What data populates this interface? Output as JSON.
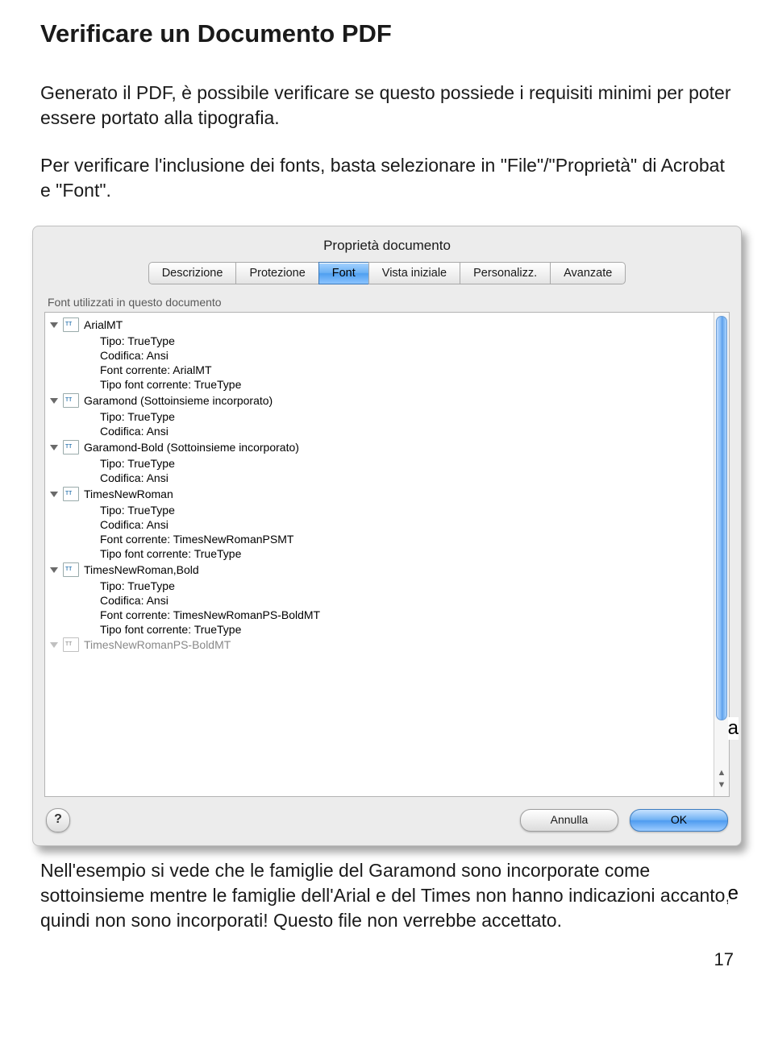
{
  "heading": "Verificare un Documento PDF",
  "intro1": "Generato il PDF, è possibile verificare se questo possiede i requisiti minimi per poter essere portato alla tipografia.",
  "intro2": "Per verificare l'inclusione dei fonts, basta selezionare in \"File\"/\"Proprietà\" di Acrobat e \"Font\".",
  "dialog": {
    "title": "Proprietà documento",
    "tabs": [
      "Descrizione",
      "Protezione",
      "Font",
      "Vista iniziale",
      "Personalizz.",
      "Avanzate"
    ],
    "active_tab": 2,
    "group_label": "Font utilizzati in questo documento",
    "fonts": [
      {
        "name": "ArialMT",
        "details": [
          "Tipo: TrueType",
          "Codifica: Ansi",
          "Font corrente: ArialMT",
          "Tipo font corrente: TrueType"
        ]
      },
      {
        "name": "Garamond (Sottoinsieme incorporato)",
        "details": [
          "Tipo: TrueType",
          "Codifica: Ansi"
        ]
      },
      {
        "name": "Garamond-Bold (Sottoinsieme incorporato)",
        "details": [
          "Tipo: TrueType",
          "Codifica: Ansi"
        ]
      },
      {
        "name": "TimesNewRoman",
        "details": [
          "Tipo: TrueType",
          "Codifica: Ansi",
          "Font corrente: TimesNewRomanPSMT",
          "Tipo font corrente: TrueType"
        ]
      },
      {
        "name": "TimesNewRoman,Bold",
        "details": [
          "Tipo: TrueType",
          "Codifica: Ansi",
          "Font corrente: TimesNewRomanPS-BoldMT",
          "Tipo font corrente: TrueType"
        ]
      }
    ],
    "cutoff_font": "TimesNewRomanPS-BoldMT",
    "help_label": "?",
    "cancel_label": "Annulla",
    "ok_label": "OK"
  },
  "stray_a": "a",
  "stray_e": "e",
  "outro": "Nell'esempio si vede che le famiglie del Garamond sono incorporate come sottoinsieme mentre le famiglie dell'Arial e del Times non hanno indicazioni accanto, quindi non sono incorporati! Questo file non verrebbe accettato.",
  "page_number": "17"
}
